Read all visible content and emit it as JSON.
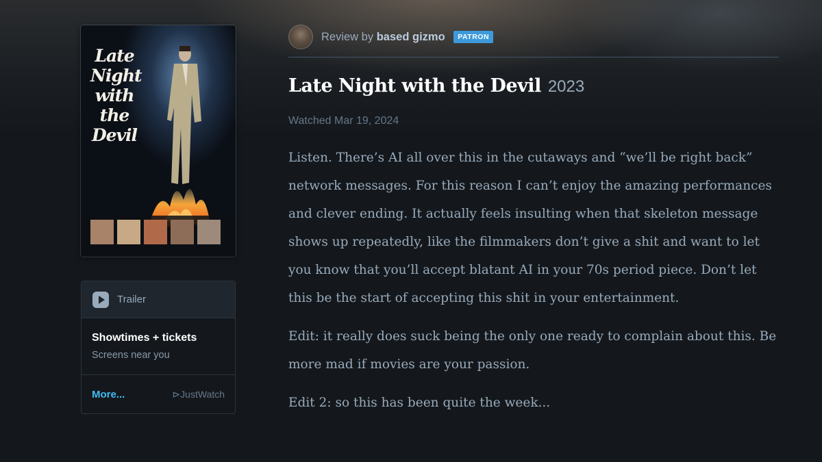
{
  "poster": {
    "title_lines": "Late\nNight\nwith\nthe\nDevil"
  },
  "watch_box": {
    "trailer_label": "Trailer",
    "showtimes_title": "Showtimes + tickets",
    "showtimes_sub": "Screens near you",
    "more_label": "More...",
    "provider": "JustWatch"
  },
  "review": {
    "by_prefix": "Review by",
    "reviewer": "based gizmo",
    "badge": "PATRON",
    "film_title": "Late Night with the Devil",
    "film_year": "2023",
    "watched": "Watched Mar 19, 2024",
    "paragraphs": [
      "Listen. There’s AI all over this in the cutaways and “we’ll be right back” network messages. For this reason I can’t enjoy the amazing performances and clever ending. It actually feels insulting when that skeleton message shows up repeatedly, like the filmmakers don’t give a shit and want to let you know that you’ll accept blatant AI in your 70s period piece. Don’t let this be the start of accepting this shit in your entertainment.",
      "Edit: it really does suck being the only one ready to complain about this. Be more mad if movies are your passion.",
      "Edit 2: so this has been quite the week..."
    ]
  },
  "colors": {
    "background": "#14181c",
    "accent_link": "#40bcf4",
    "badge": "#3c9adb",
    "body_text": "#99aabb"
  },
  "icons": {
    "play": "play-icon",
    "justwatch": "justwatch-logo-icon"
  }
}
